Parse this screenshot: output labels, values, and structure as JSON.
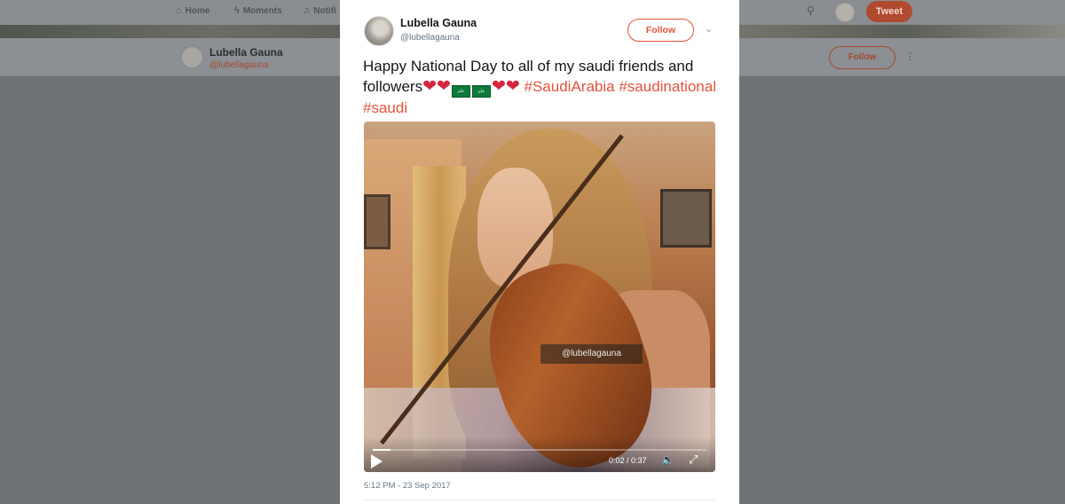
{
  "background": {
    "nav": {
      "home": "Home",
      "moments": "Moments",
      "notifications": "Notifi",
      "tweet_button": "Tweet"
    },
    "profile": {
      "name": "Lubella Gauna",
      "handle": "@lubellagauna",
      "follow_label": "Follow"
    }
  },
  "tweet": {
    "author_name": "Lubella Gauna",
    "author_handle": "@lubellagauna",
    "follow_label": "Follow",
    "text_main": "Happy National Day to all of my saudi friends and followers",
    "flag_text": "علم",
    "hashtag_1": "#SaudiArabia",
    "hashtag_2": "#saudinational",
    "hashtag_3": "#saudi",
    "timestamp": "5:12 PM - 23 Sep 2017"
  },
  "video": {
    "watermark": "@lubellagauna",
    "current_time": "0:02",
    "duration": "0:37",
    "time_display": "0:02 / 0:37",
    "progress": 0.054
  },
  "colors": {
    "accent": "#e0533b",
    "heart": "#d6253f",
    "flag_green": "#0d7a3a",
    "overlay": "#6f7378"
  },
  "icons": [
    "home-icon",
    "moments-icon",
    "notifications-icon",
    "search-icon",
    "chevron-down-icon",
    "play-icon",
    "volume-icon",
    "fullscreen-icon",
    "heart-icon",
    "saudi-flag-icon"
  ]
}
